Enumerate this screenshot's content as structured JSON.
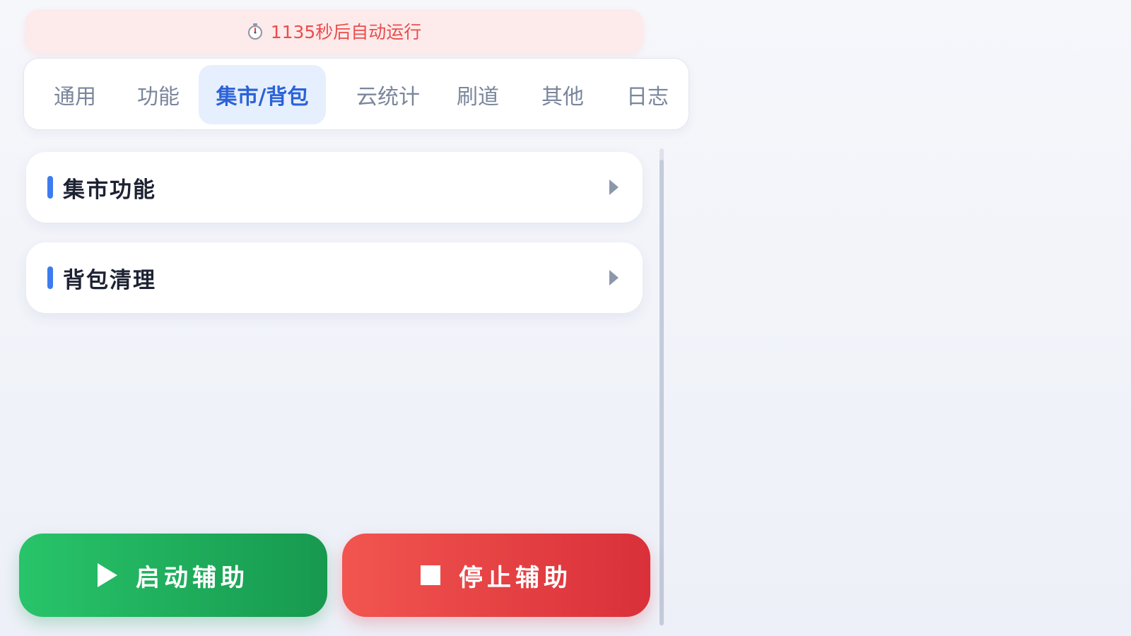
{
  "banner": {
    "icon": "stopwatch-icon",
    "text": "1135秒后自动运行",
    "color": "#ea4d4d"
  },
  "tabs": [
    {
      "label": "通用",
      "active": false
    },
    {
      "label": "功能",
      "active": false
    },
    {
      "label": "集市/背包",
      "active": true
    },
    {
      "label": "云统计",
      "active": false
    },
    {
      "label": "刷道",
      "active": false
    },
    {
      "label": "其他",
      "active": false
    },
    {
      "label": "日志",
      "active": false
    }
  ],
  "sections": [
    {
      "title": "集市功能",
      "icon": "chevron-right-icon"
    },
    {
      "title": "背包清理",
      "icon": "chevron-right-icon"
    }
  ],
  "actions": {
    "start_label": "启动辅助",
    "start_icon": "play-icon",
    "stop_label": "停止辅助",
    "stop_icon": "stop-icon"
  },
  "colors": {
    "accent": "#2b63d8",
    "start": "#1fae5c",
    "stop": "#e2403f"
  }
}
